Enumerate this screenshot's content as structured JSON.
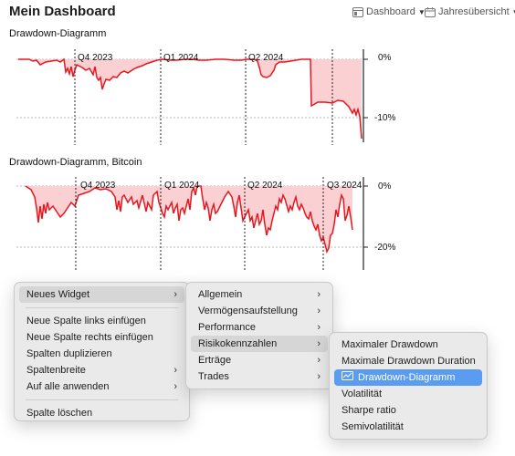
{
  "header": {
    "title": "Mein Dashboard",
    "dashboard_label": "Dashboard",
    "period_label": "Jahresübersicht"
  },
  "charts": [
    {
      "title": "Drawdown-Diagramm",
      "quarter_labels": [
        "Q4 2023",
        "Q1 2024",
        "Q2 2024"
      ],
      "y_labels": [
        "0%",
        "-10%"
      ]
    },
    {
      "title": "Drawdown-Diagramm, Bitcoin",
      "quarter_labels": [
        "Q4 2023",
        "Q1 2024",
        "Q2 2024",
        "Q3 2024"
      ],
      "y_labels": [
        "0%",
        "-20%"
      ]
    }
  ],
  "context_menu": {
    "items": [
      "Neues Widget",
      "Neue Spalte links einfügen",
      "Neue Spalte rechts einfügen",
      "Spalten duplizieren",
      "Spaltenbreite",
      "Auf alle anwenden",
      "Spalte löschen"
    ]
  },
  "widget_menu": {
    "items": [
      "Allgemein",
      "Vermögensaufstellung",
      "Performance",
      "Risikokennzahlen",
      "Erträge",
      "Trades"
    ]
  },
  "risk_menu": {
    "items": [
      "Maximaler Drawdown",
      "Maximale Drawdown Duration",
      "Drawdown-Diagramm",
      "Volatilität",
      "Sharpe ratio",
      "Semivolatilität"
    ]
  },
  "colors": {
    "line": "#e8161e",
    "fill": "#fbd0d3",
    "selection": "#5a9cf0"
  },
  "icons": {
    "dashboard": "dashboard-icon",
    "calendar": "calendar-icon",
    "chart": "line-chart-icon"
  }
}
